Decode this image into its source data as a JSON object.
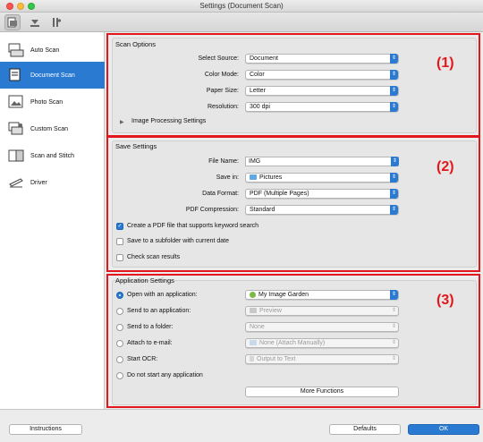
{
  "window": {
    "title": "Settings (Document Scan)"
  },
  "toolbar": {
    "icons": [
      "scan-settings-icon",
      "download-icon",
      "tools-icon"
    ]
  },
  "sidebar": {
    "items": [
      {
        "label": "Auto Scan",
        "icon": "auto-scan-icon",
        "selected": false
      },
      {
        "label": "Document Scan",
        "icon": "document-scan-icon",
        "selected": true
      },
      {
        "label": "Photo Scan",
        "icon": "photo-scan-icon",
        "selected": false
      },
      {
        "label": "Custom Scan",
        "icon": "custom-scan-icon",
        "selected": false
      },
      {
        "label": "Scan and Stitch",
        "icon": "scan-stitch-icon",
        "selected": false
      },
      {
        "label": "Driver",
        "icon": "driver-icon",
        "selected": false
      }
    ]
  },
  "scan_options": {
    "title": "Scan Options",
    "marker": "(1)",
    "select_source": {
      "label": "Select Source:",
      "value": "Document"
    },
    "color_mode": {
      "label": "Color Mode:",
      "value": "Color"
    },
    "paper_size": {
      "label": "Paper Size:",
      "value": "Letter"
    },
    "resolution": {
      "label": "Resolution:",
      "value": "300 dpi"
    },
    "image_processing": "Image Processing Settings"
  },
  "save_settings": {
    "title": "Save Settings",
    "marker": "(2)",
    "file_name": {
      "label": "File Name:",
      "value": "IMG"
    },
    "save_in": {
      "label": "Save in:",
      "value": "Pictures"
    },
    "data_format": {
      "label": "Data Format:",
      "value": "PDF (Multiple Pages)"
    },
    "pdf_compression": {
      "label": "PDF Compression:",
      "value": "Standard"
    },
    "keyword_search": {
      "label": "Create a PDF file that supports keyword search",
      "checked": true
    },
    "subfolder": {
      "label": "Save to a subfolder with current date",
      "checked": false
    },
    "check_results": {
      "label": "Check scan results",
      "checked": false
    }
  },
  "app_settings": {
    "title": "Application Settings",
    "marker": "(3)",
    "open_app": {
      "label": "Open with an application:",
      "value": "My Image Garden",
      "selected": true
    },
    "send_app": {
      "label": "Send to an application:",
      "value": "Preview",
      "selected": false
    },
    "send_folder": {
      "label": "Send to a folder:",
      "value": "None",
      "selected": false
    },
    "attach_email": {
      "label": "Attach to e-mail:",
      "value": "None (Attach Manually)",
      "selected": false
    },
    "start_ocr": {
      "label": "Start OCR:",
      "value": "Output to Text",
      "selected": false
    },
    "no_app": {
      "label": "Do not start any application",
      "selected": false
    },
    "more_functions": "More Functions"
  },
  "footer": {
    "instructions": "Instructions",
    "defaults": "Defaults",
    "ok": "OK"
  },
  "colors": {
    "accent": "#2a7ad2",
    "highlight": "#e3171b"
  }
}
